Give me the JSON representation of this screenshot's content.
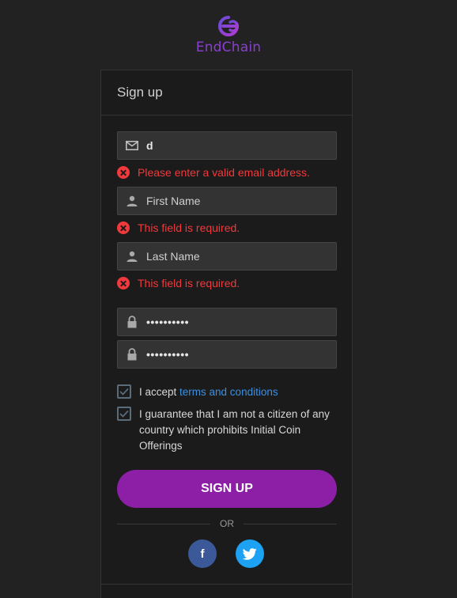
{
  "brand": {
    "name": "EndChain",
    "color": "#8a3fd1"
  },
  "card": {
    "title": "Sign up"
  },
  "form": {
    "email": {
      "value": "d",
      "icon": "mail-icon"
    },
    "email_error": "Please enter a valid email address.",
    "first_name": {
      "placeholder": "First Name",
      "icon": "user-icon"
    },
    "first_name_error": "This field is required.",
    "last_name": {
      "placeholder": "Last Name",
      "icon": "user-icon"
    },
    "last_name_error": "This field is required.",
    "password": {
      "value": "••••••••••",
      "icon": "lock-icon"
    },
    "password_confirm": {
      "value": "••••••••••",
      "icon": "lock-icon"
    },
    "terms": {
      "prefix": "I accept ",
      "link": "terms and conditions",
      "checked": true
    },
    "citizen": {
      "label": "I guarantee that I am not a citizen of any country which prohibits Initial Coin Offerings",
      "checked": true
    },
    "submit_label": "SIGN UP",
    "or_label": "OR"
  },
  "social": {
    "facebook_label": "f",
    "colors": {
      "facebook": "#3b5998",
      "twitter": "#1da1f2",
      "button": "#8c1fa6",
      "error": "#f0393c",
      "link": "#3d8fe0"
    }
  }
}
